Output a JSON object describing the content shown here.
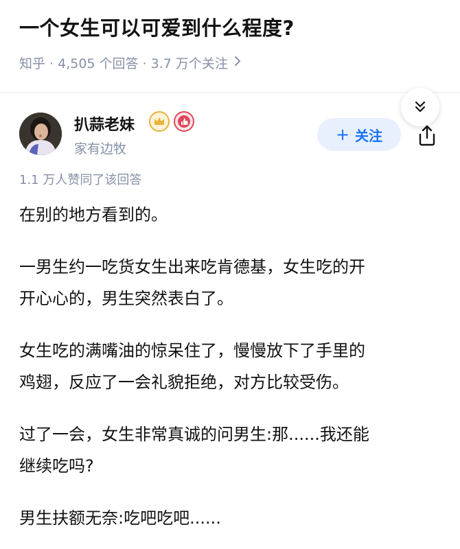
{
  "question": {
    "title": "一个女生可以可爱到什么程度?",
    "meta": "知乎 · 4,505 个回答 · 3.7 万个关注"
  },
  "author": {
    "name": "扒蒜老妹",
    "bio": "家有边牧",
    "follow_label": "关注",
    "badge_colors": {
      "crown": "#e8b23a",
      "like": "#e0475b"
    }
  },
  "answer": {
    "approve_text": "1.1 万人赞同了该回答",
    "paragraphs": [
      "在别的地方看到的。",
      "一男生约一吃货女生出来吃肯德基，女生吃的开\n开心心的，男生突然表白了。",
      "女生吃的满嘴油的惊呆住了，慢慢放下了手里的\n鸡翅，反应了一会礼貌拒绝，对方比较受伤。",
      "过了一会，女生非常真诚的问男生:那......我还能\n继续吃吗?",
      "男生扶额无奈:吃吧吃吧......"
    ]
  },
  "icons": {
    "meta_chevron": "chevron-right-icon",
    "collapse": "double-chevron-down-icon",
    "share": "share-icon"
  },
  "colors": {
    "accent": "#1772f6",
    "follow_bg": "#e8f0fe",
    "meta_text": "#8590a6"
  }
}
